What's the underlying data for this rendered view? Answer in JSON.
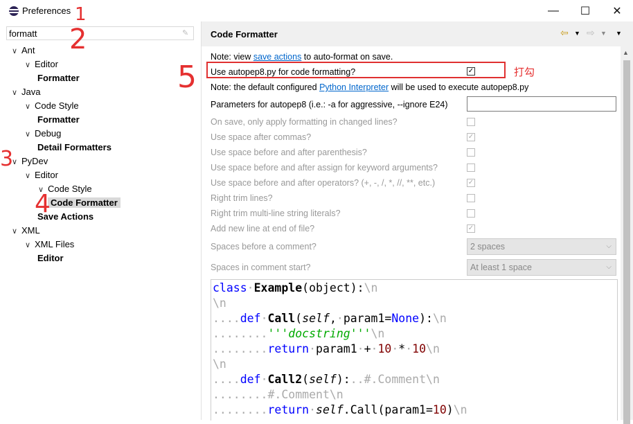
{
  "window": {
    "title": "Preferences"
  },
  "filter": {
    "value": "formatt"
  },
  "tree": [
    {
      "label": "Ant",
      "level": 0,
      "bold": false
    },
    {
      "label": "Editor",
      "level": 1,
      "bold": false
    },
    {
      "label": "Formatter",
      "level": 2,
      "bold": true
    },
    {
      "label": "Java",
      "level": 0,
      "bold": false
    },
    {
      "label": "Code Style",
      "level": 1,
      "bold": false
    },
    {
      "label": "Formatter",
      "level": 2,
      "bold": true
    },
    {
      "label": "Debug",
      "level": 1,
      "bold": false
    },
    {
      "label": "Detail Formatters",
      "level": 2,
      "bold": true
    },
    {
      "label": "PyDev",
      "level": 0,
      "bold": false
    },
    {
      "label": "Editor",
      "level": 1,
      "bold": false
    },
    {
      "label": "Code Style",
      "level": 2,
      "bold": false
    },
    {
      "label": "Code Formatter",
      "level": 3,
      "bold": true,
      "selected": true
    },
    {
      "label": "Save Actions",
      "level": 2,
      "bold": true
    },
    {
      "label": "XML",
      "level": 0,
      "bold": false
    },
    {
      "label": "XML Files",
      "level": 1,
      "bold": false
    },
    {
      "label": "Editor",
      "level": 2,
      "bold": true
    }
  ],
  "page": {
    "title": "Code Formatter",
    "note1_prefix": "Note: view ",
    "note1_link": "save actions",
    "note1_suffix": " to auto-format on save.",
    "autopep8_label": "Use autopep8.py for code formatting?",
    "note2_prefix": "Note: the default configured ",
    "note2_link": "Python Interpreter",
    "note2_suffix": " will be used to execute autopep8.py",
    "params_label": "Parameters for autopep8 (i.e.: -a for aggressive, --ignore E24)",
    "params_value": "",
    "options": [
      {
        "label": "On save, only apply formatting in changed lines?",
        "checked": false
      },
      {
        "label": "Use space after commas?",
        "checked": true
      },
      {
        "label": "Use space before and after parenthesis?",
        "checked": false
      },
      {
        "label": "Use space before and after assign for keyword arguments?",
        "checked": false
      },
      {
        "label": "Use space before and after operators? (+, -, /, *, //, **, etc.)",
        "checked": true
      },
      {
        "label": "Right trim lines?",
        "checked": false
      },
      {
        "label": "Right trim multi-line string literals?",
        "checked": false
      },
      {
        "label": "Add new line at end of file?",
        "checked": true
      }
    ],
    "spaces_before_label": "Spaces before a comment?",
    "spaces_before_value": "2 spaces",
    "spaces_start_label": "Spaces in comment start?",
    "spaces_start_value": "At least 1 space"
  },
  "annotations": {
    "n1": "1",
    "n2": "2",
    "n3": "3",
    "n4": "4",
    "n5": "5",
    "check_note": "打勾"
  },
  "icons": [
    "app-icon",
    "minimize-icon",
    "maximize-icon",
    "close-icon",
    "back-icon",
    "forward-icon",
    "menu-icon",
    "clear-icon"
  ]
}
